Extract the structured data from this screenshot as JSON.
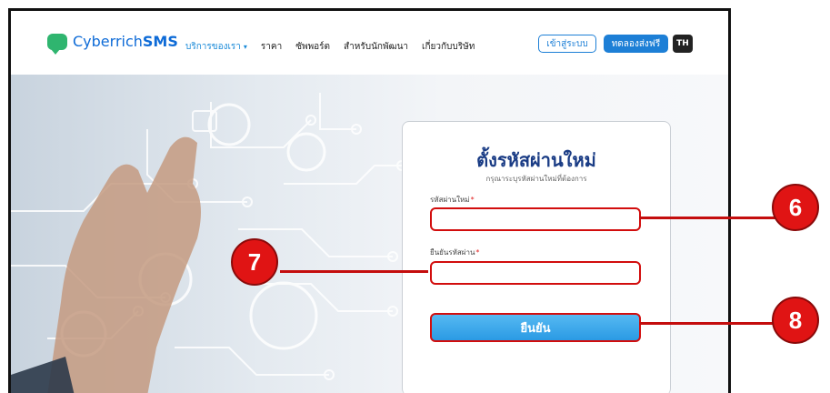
{
  "nav": {
    "logo_prefix": "Cyberrich",
    "logo_suffix": "SMS",
    "menu": [
      {
        "label": "บริการของเรา",
        "active": true
      },
      {
        "label": "ราคา"
      },
      {
        "label": "ซัพพอร์ต"
      },
      {
        "label": "สำหรับนักพัฒนา"
      },
      {
        "label": "เกี่ยวกับบริษัท"
      }
    ],
    "login_label": "เข้าสู่ระบบ",
    "trial_label": "ทดลองส่งฟรี",
    "lang_label": "TH"
  },
  "form": {
    "title": "ตั้งรหัสผ่านใหม่",
    "subtitle": "กรุณาระบุรหัสผ่านใหม่ที่ต้องการ",
    "new_password_label": "รหัสผ่านใหม่",
    "confirm_password_label": "ยืนยันรหัสผ่าน",
    "required_mark": "*",
    "new_password_value": "",
    "confirm_password_value": "",
    "submit_label": "ยืนยัน"
  },
  "callouts": [
    "6",
    "7",
    "8"
  ],
  "colors": {
    "brand_blue": "#1d7fd6",
    "brand_green": "#2fb56f",
    "title_navy": "#1a3c85",
    "annotation_red": "#e01414"
  }
}
